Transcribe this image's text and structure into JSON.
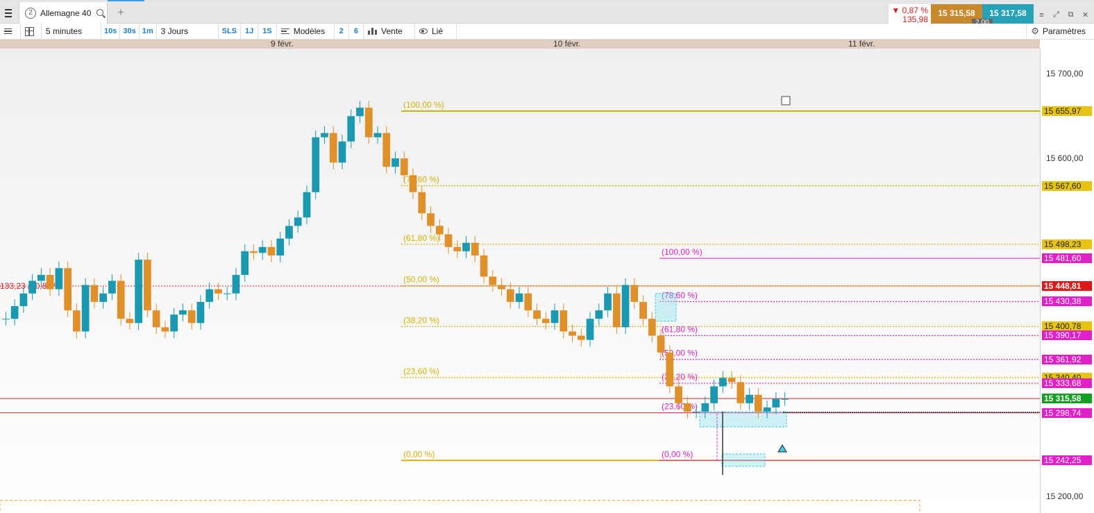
{
  "tab": {
    "number": "2",
    "title": "Allemagne 40"
  },
  "quote": {
    "change_pct": "▼ 0,87 %",
    "change_abs": "135,98",
    "bid": "15 315,58",
    "ask": "15 317,58",
    "spread": "2,00"
  },
  "toolbar": {
    "interval": "5 minutes",
    "btn_10s": "10s",
    "btn_30s": "30s",
    "btn_1m": "1m",
    "range": "3 Jours",
    "btn_sls": "SLS",
    "btn_1j": "1J",
    "btn_1s": "1S",
    "templates": "Modèles",
    "btn_2": "2",
    "btn_6": "6",
    "side": "Vente",
    "linked": "Lié",
    "settings": "Paramètres"
  },
  "date_axis": [
    "9 févr.",
    "10 févr.",
    "11 févr."
  ],
  "price_axis": {
    "ticks": [
      "15 700,00",
      "15 600,00",
      "15 200,00"
    ],
    "tags": [
      {
        "label": "15 655,97",
        "kind": "fib-gold"
      },
      {
        "label": "15 567,60",
        "kind": "fib-gold"
      },
      {
        "label": "15 498,23",
        "kind": "fib-gold"
      },
      {
        "label": "15 481,60",
        "kind": "fib-pink"
      },
      {
        "label": "15 448,81",
        "kind": "ref-red"
      },
      {
        "label": "15 430,38",
        "kind": "fib-pink"
      },
      {
        "label": "15 400,78",
        "kind": "fib-gold"
      },
      {
        "label": "15 390,17",
        "kind": "fib-pink"
      },
      {
        "label": "15 361,92",
        "kind": "fib-pink"
      },
      {
        "label": "15 340,40",
        "kind": "fib-gold"
      },
      {
        "label": "15 333,68",
        "kind": "fib-pink"
      },
      {
        "label": "15 315,58",
        "kind": "last-green"
      },
      {
        "label": "15 298,74",
        "kind": "fib-pink"
      },
      {
        "label": "15 242,25",
        "kind": "fib-pink"
      }
    ]
  },
  "chart_data": {
    "type": "candlestick",
    "instrument": "Allemagne 40",
    "interval": "5 minutes",
    "range": "3 Jours",
    "ylim": [
      15180,
      15730
    ],
    "reference_line": {
      "price": 15448.81,
      "label": "133,23 / -0,86 %"
    },
    "fibonacci_sets": [
      {
        "color": "#d4b106",
        "high": 15655.97,
        "low": 15242.25,
        "levels": [
          {
            "label": "(100,00 %)",
            "price": 15655.97
          },
          {
            "label": "(78,60 %)",
            "price": 15567.6
          },
          {
            "label": "(61,80 %)",
            "price": 15498.23
          },
          {
            "label": "(50,00 %)",
            "price": 15449.11
          },
          {
            "label": "(38,20 %)",
            "price": 15400.78
          },
          {
            "label": "(23,60 %)",
            "price": 15340.4
          },
          {
            "label": "(0,00 %)",
            "price": 15242.25
          }
        ]
      },
      {
        "color": "#e020c8",
        "high": 15481.6,
        "low": 15242.25,
        "levels": [
          {
            "label": "(100,00 %)",
            "price": 15481.6
          },
          {
            "label": "(78,60 %)",
            "price": 15430.38
          },
          {
            "label": "(61,80 %)",
            "price": 15390.17
          },
          {
            "label": "(50,00 %)",
            "price": 15361.92
          },
          {
            "label": "(38,20 %)",
            "price": 15333.68
          },
          {
            "label": "(23,60 %)",
            "price": 15298.74
          },
          {
            "label": "(0,00 %)",
            "price": 15242.25
          }
        ]
      }
    ],
    "horizontal_lines": [
      15315.58,
      15298.74
    ],
    "last_price": 15315.58,
    "series_close": [
      15410,
      15425,
      15440,
      15455,
      15462,
      15445,
      15470,
      15420,
      15395,
      15450,
      15430,
      15440,
      15455,
      15410,
      15405,
      15480,
      15420,
      15400,
      15395,
      15415,
      15420,
      15405,
      15430,
      15445,
      15440,
      15440,
      15462,
      15490,
      15488,
      15495,
      15485,
      15505,
      15520,
      15530,
      15560,
      15625,
      15630,
      15595,
      15620,
      15650,
      15660,
      15625,
      15630,
      15590,
      15600,
      15580,
      15560,
      15535,
      15520,
      15510,
      15495,
      15490,
      15500,
      15485,
      15460,
      15450,
      15445,
      15430,
      15440,
      15420,
      15410,
      15405,
      15420,
      15395,
      15390,
      15385,
      15410,
      15420,
      15440,
      15400,
      15450,
      15430,
      15410,
      15390,
      15370,
      15330,
      15310,
      15300,
      15300,
      15310,
      15330,
      15340,
      15335,
      15310,
      15320,
      15300,
      15305,
      15315,
      15315
    ],
    "annotations": [
      "Fibonacci retracements",
      "rectangles"
    ]
  }
}
